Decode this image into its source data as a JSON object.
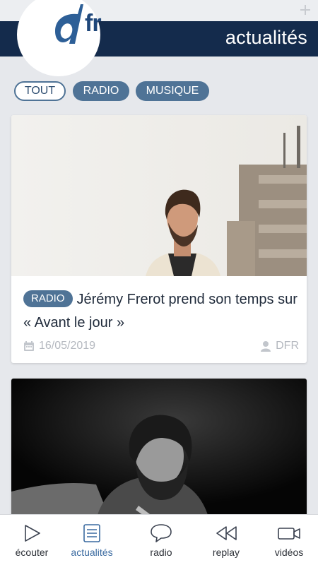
{
  "header": {
    "logo_text": "fr",
    "title": "actualités"
  },
  "filters": [
    "TOUT",
    "RADIO",
    "MUSIQUE"
  ],
  "articles": [
    {
      "category": "RADIO",
      "title": "Jérémy Frerot prend son temps sur « Avant le jour »",
      "date": "16/05/2019",
      "author": "DFR"
    }
  ],
  "nav": {
    "items": [
      "écouter",
      "actualités",
      "radio",
      "replay",
      "vidéos"
    ],
    "active": "actualités"
  },
  "colors": {
    "header": "#142b4c",
    "accent": "#4f7396",
    "active_nav": "#3a6aa0"
  }
}
